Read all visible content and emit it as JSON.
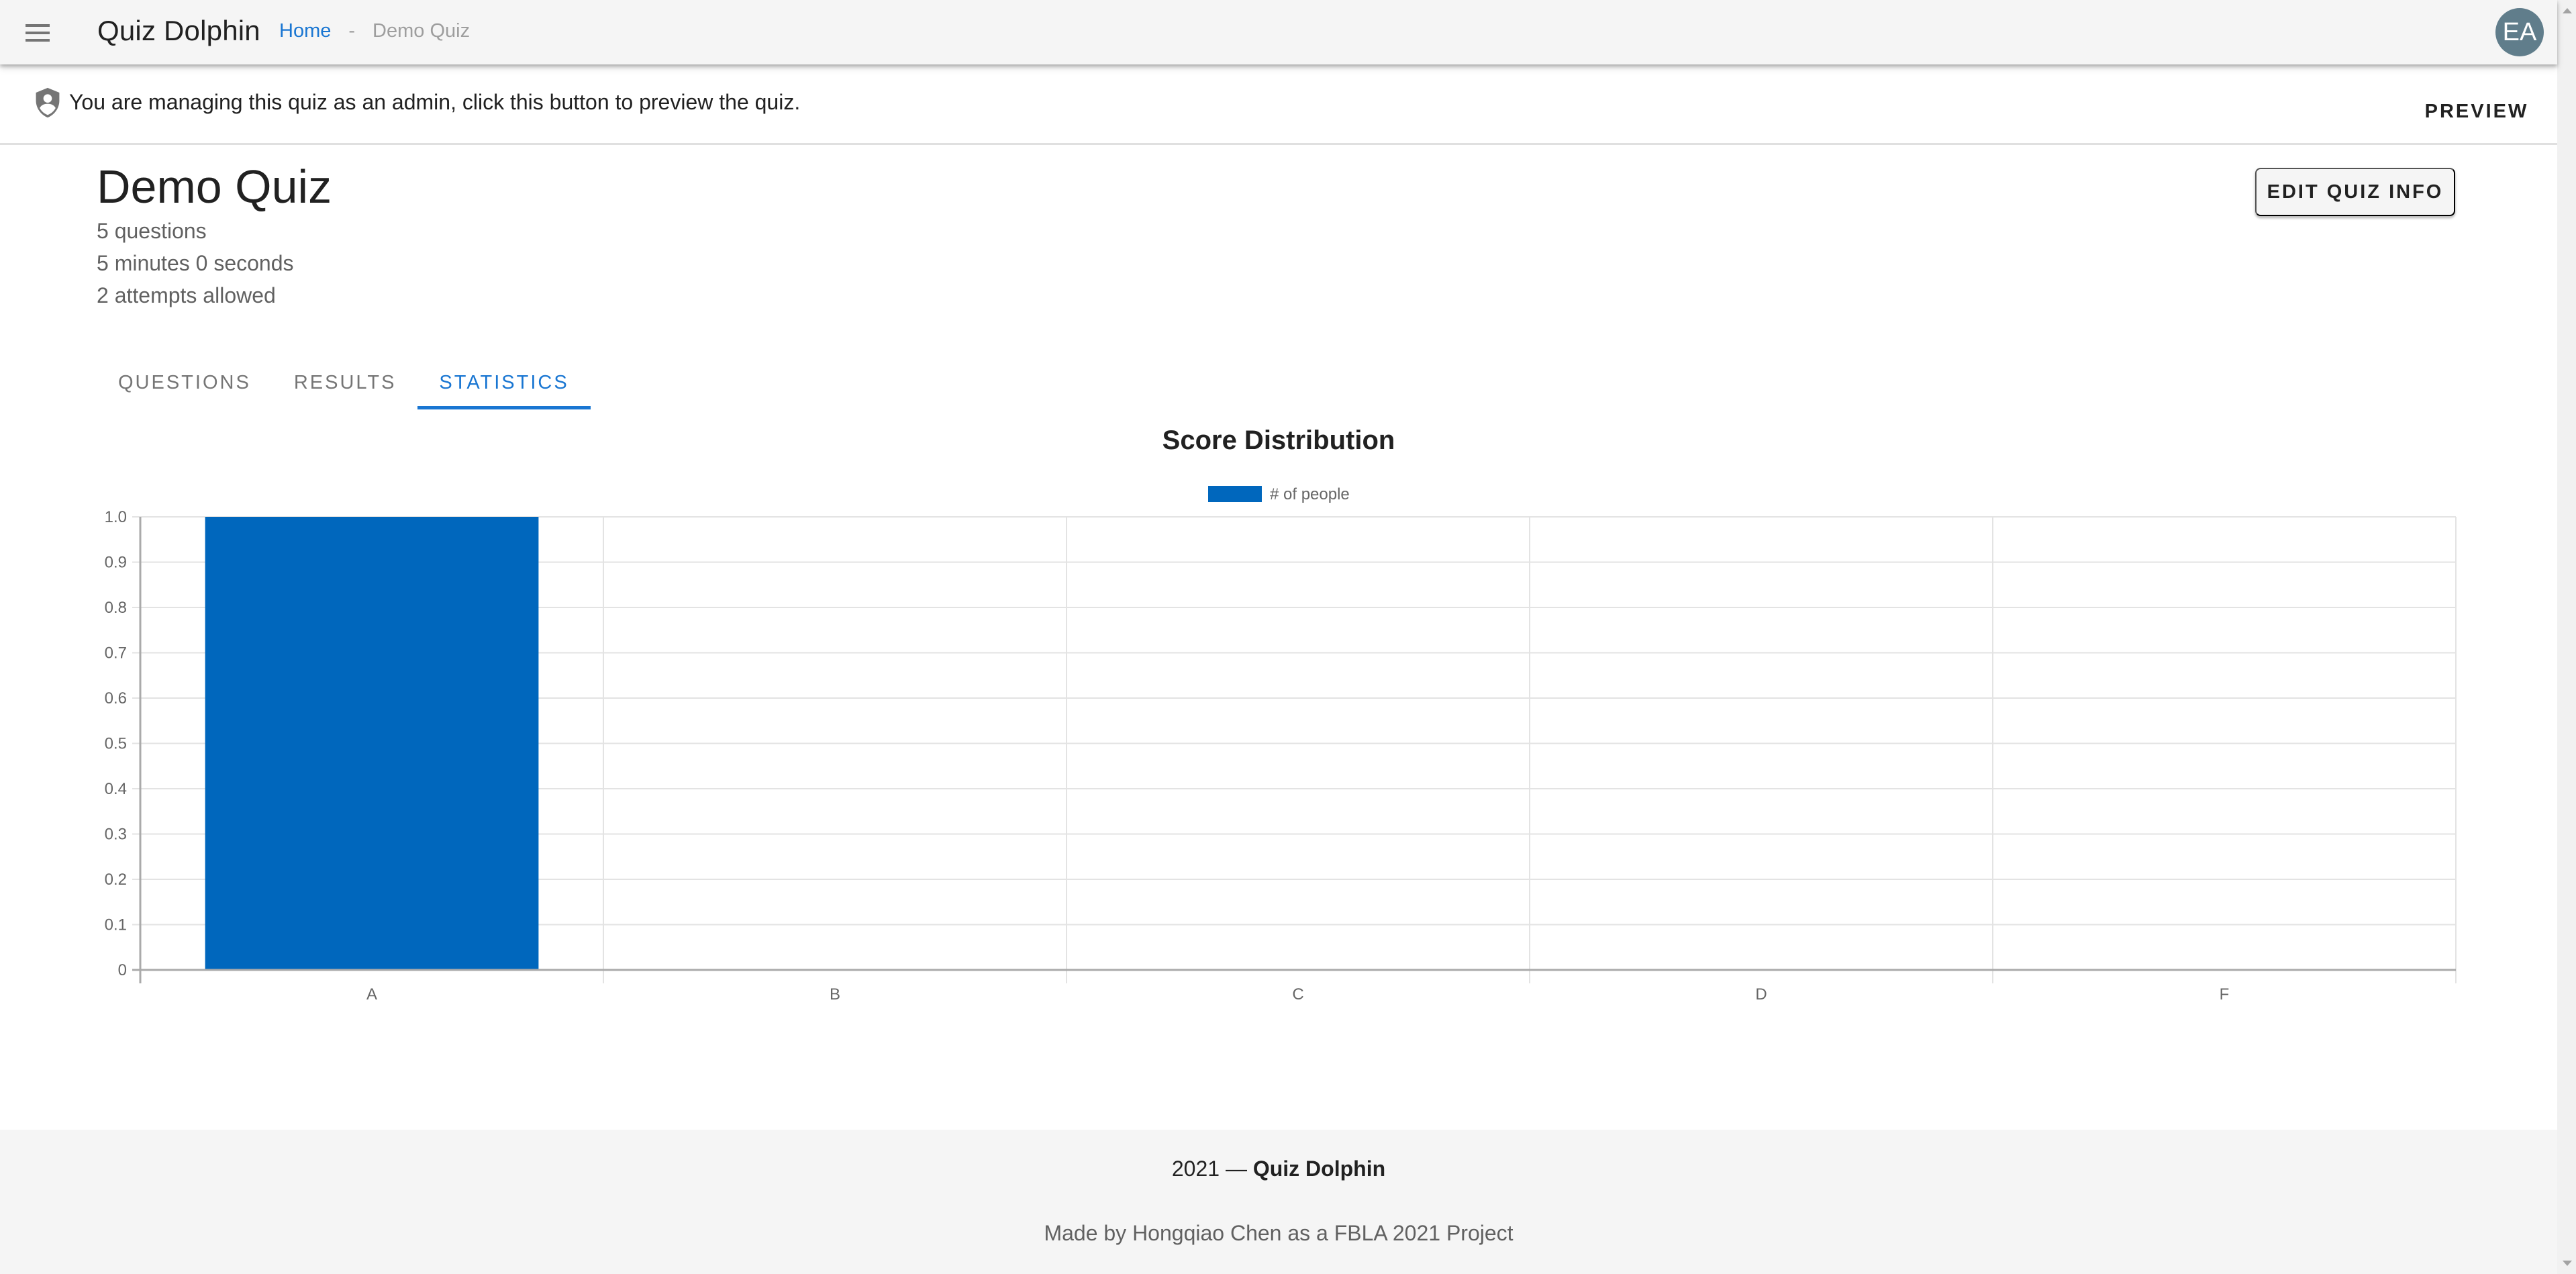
{
  "app": {
    "title": "Quiz Dolphin",
    "menu_icon": "hamburger-menu-icon",
    "avatar_initials": "EA",
    "avatar_color": "#607d8b"
  },
  "breadcrumb": {
    "home": "Home",
    "separator": "-",
    "current": "Demo Quiz"
  },
  "banner": {
    "icon": "shield-account-icon",
    "text": "You are managing this quiz as an admin, click this button to preview the quiz.",
    "preview_label": "PREVIEW"
  },
  "quiz": {
    "title": "Demo Quiz",
    "questions": "5 questions",
    "time_limit": "5 minutes 0 seconds",
    "attempts": "2 attempts allowed",
    "edit_label": "EDIT QUIZ INFO"
  },
  "tabs": [
    {
      "label": "QUESTIONS",
      "active": false
    },
    {
      "label": "RESULTS",
      "active": false
    },
    {
      "label": "STATISTICS",
      "active": true
    }
  ],
  "colors": {
    "accent": "#1976d2",
    "bar": "#0067bd"
  },
  "chart_data": {
    "type": "bar",
    "title": "Score Distribution",
    "categories": [
      "A",
      "B",
      "C",
      "D",
      "F"
    ],
    "series": [
      {
        "name": "# of people",
        "values": [
          1,
          0,
          0,
          0,
          0
        ]
      }
    ],
    "xlabel": "",
    "ylabel": "",
    "ylim": [
      0,
      1.0
    ],
    "yticks": [
      0,
      0.1,
      0.2,
      0.3,
      0.4,
      0.5,
      0.6,
      0.7,
      0.8,
      0.9,
      1.0
    ],
    "ytick_labels": [
      "0",
      "0.1",
      "0.2",
      "0.3",
      "0.4",
      "0.5",
      "0.6",
      "0.7",
      "0.8",
      "0.9",
      "1.0"
    ],
    "grid": true,
    "legend": "top-center"
  },
  "footer": {
    "year": "2021 —",
    "brand": "Quiz Dolphin",
    "credit": "Made by Hongqiao Chen as a FBLA 2021 Project"
  }
}
